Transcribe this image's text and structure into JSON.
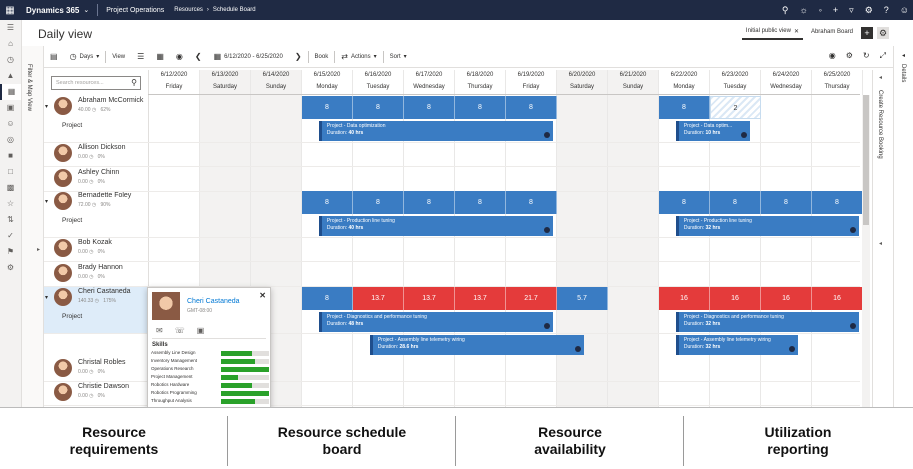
{
  "topbar": {
    "brand": "Dynamics 365",
    "area": "Project Operations",
    "crumb_1": "Resources",
    "crumb_2": "Schedule Board"
  },
  "header": {
    "title": "Daily view",
    "tab_initial": "Initial public view",
    "tab_board": "Abraham Board"
  },
  "rails": {
    "filter": "Filter & Map View",
    "create": "Create Resource Booking",
    "details": "Details"
  },
  "toolbar": {
    "days": "Days",
    "view": "View",
    "date_range": "6/12/2020 - 6/25/2020",
    "book": "Book",
    "actions": "Actions",
    "sort": "Sort"
  },
  "search": {
    "placeholder": "Search resources..."
  },
  "days": [
    {
      "date": "6/12/2020",
      "weekday": "Friday",
      "weekend": false
    },
    {
      "date": "6/13/2020",
      "weekday": "Saturday",
      "weekend": true
    },
    {
      "date": "6/14/2020",
      "weekday": "Sunday",
      "weekend": true
    },
    {
      "date": "6/15/2020",
      "weekday": "Monday",
      "weekend": false
    },
    {
      "date": "6/16/2020",
      "weekday": "Tuesday",
      "weekend": false
    },
    {
      "date": "6/17/2020",
      "weekday": "Wednesday",
      "weekend": false
    },
    {
      "date": "6/18/2020",
      "weekday": "Thursday",
      "weekend": false
    },
    {
      "date": "6/19/2020",
      "weekday": "Friday",
      "weekend": false
    },
    {
      "date": "6/20/2020",
      "weekday": "Saturday",
      "weekend": true
    },
    {
      "date": "6/21/2020",
      "weekday": "Sunday",
      "weekend": true
    },
    {
      "date": "6/22/2020",
      "weekday": "Monday",
      "weekend": false
    },
    {
      "date": "6/23/2020",
      "weekday": "Tuesday",
      "weekend": false
    },
    {
      "date": "6/24/2020",
      "weekday": "Wednesday",
      "weekend": false
    },
    {
      "date": "6/25/2020",
      "weekday": "Thursday",
      "weekend": false
    }
  ],
  "resources": [
    {
      "name": "Abraham McCormick",
      "hours": "40.00",
      "util": "62%",
      "expanded": true,
      "project": "Project"
    },
    {
      "name": "Allison Dickson",
      "hours": "0.00",
      "util": "0%",
      "expanded": false
    },
    {
      "name": "Ashley Chinn",
      "hours": "0.00",
      "util": "0%",
      "expanded": false
    },
    {
      "name": "Bernadette Foley",
      "hours": "72.00",
      "util": "90%",
      "expanded": true,
      "project": "Project"
    },
    {
      "name": "Bob Kozak",
      "hours": "0.00",
      "util": "0%",
      "expanded": false
    },
    {
      "name": "Brady Hannon",
      "hours": "0.00",
      "util": "0%",
      "expanded": false
    },
    {
      "name": "Cheri Castaneda",
      "hours": "140.33",
      "util": "175%",
      "expanded": true,
      "project": "Project",
      "selected": true
    },
    {
      "name": "Christal Robles",
      "hours": "0.00",
      "util": "0%",
      "expanded": false
    },
    {
      "name": "Christie Dawson",
      "hours": "0.00",
      "util": "0%",
      "expanded": false
    }
  ],
  "availability": [
    {
      "row": 0,
      "cells": [
        [
          "",
          "",
          "",
          "8",
          "8",
          "8",
          "8",
          "8",
          "",
          "",
          "8",
          "2",
          "",
          ""
        ]
      ]
    },
    {
      "row": 3,
      "cells": [
        [
          "",
          "",
          "",
          "8",
          "8",
          "8",
          "8",
          "8",
          "",
          "",
          "8",
          "8",
          "8",
          "8"
        ]
      ]
    },
    {
      "row": 6,
      "cells": [
        [
          "",
          "",
          "",
          "8",
          "13.7",
          "13.7",
          "13.7",
          "21.7",
          "5.7",
          "",
          "16",
          "16",
          "16",
          "16"
        ]
      ]
    }
  ],
  "bookings": [
    {
      "title": "Project - Data optimization",
      "duration_label": "Duration:",
      "duration": "40 hrs"
    },
    {
      "title": "Project - Data optim...",
      "duration_label": "Duration:",
      "duration": "10 hrs"
    },
    {
      "title": "Project - Production line tuning",
      "duration_label": "Duration:",
      "duration": "40 hrs"
    },
    {
      "title": "Project - Production line tuning",
      "duration_label": "Duration:",
      "duration": "32 hrs"
    },
    {
      "title": "Project - Diagnostics and performance tuning",
      "duration_label": "Duration:",
      "duration": "48 hrs"
    },
    {
      "title": "Project - Diagnostics and performance tuning",
      "duration_label": "Duration:",
      "duration": "32 hrs"
    },
    {
      "title": "Project - Assembly line telemetry wiring",
      "duration_label": "Duration:",
      "duration": "28.6 hrs"
    },
    {
      "title": "Project - Assembly line telemetry wiring",
      "duration_label": "Duration:",
      "duration": "32 hrs"
    }
  ],
  "card": {
    "name": "Cheri Castaneda",
    "timezone": "GMT-08:00",
    "skills_label": "Skills",
    "skills": [
      {
        "name": "Assembly Line Design",
        "level": 0.65
      },
      {
        "name": "Inventory Management",
        "level": 0.7
      },
      {
        "name": "Operations Research",
        "level": 1.0
      },
      {
        "name": "Project Management",
        "level": 0.35
      },
      {
        "name": "Robotics Hardware",
        "level": 0.65
      },
      {
        "name": "Robotics Programming",
        "level": 1.0
      },
      {
        "name": "Throughput Analysis",
        "level": 0.7
      }
    ]
  },
  "features": [
    {
      "line1": "Resource",
      "line2": "requirements"
    },
    {
      "line1": "Resource schedule",
      "line2": "board"
    },
    {
      "line1": "Resource",
      "line2": "availability"
    },
    {
      "line1": "Utilization",
      "line2": "reporting"
    }
  ],
  "colors": {
    "booking": "#3a7cc3",
    "overbooked": "#e43b3b",
    "topbar": "#1f2a44",
    "skill": "#2aa12a"
  }
}
